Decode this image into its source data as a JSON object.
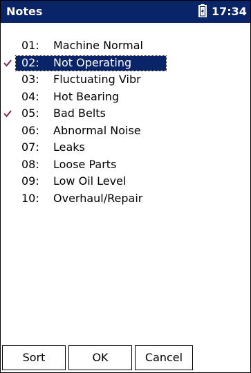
{
  "titlebar": {
    "title": "Notes",
    "time": "17:34",
    "battery_icon": "battery-charging-icon",
    "background": "#0a246a"
  },
  "notes": [
    {
      "num": "01:",
      "label": "Machine Normal",
      "checked": false,
      "selected": false
    },
    {
      "num": "02:",
      "label": "Not Operating",
      "checked": true,
      "selected": true
    },
    {
      "num": "03:",
      "label": "Fluctuating Vibr",
      "checked": false,
      "selected": false
    },
    {
      "num": "04:",
      "label": "Hot Bearing",
      "checked": false,
      "selected": false
    },
    {
      "num": "05:",
      "label": "Bad Belts",
      "checked": true,
      "selected": false
    },
    {
      "num": "06:",
      "label": "Abnormal Noise",
      "checked": false,
      "selected": false
    },
    {
      "num": "07:",
      "label": "Leaks",
      "checked": false,
      "selected": false
    },
    {
      "num": "08:",
      "label": "Loose Parts",
      "checked": false,
      "selected": false
    },
    {
      "num": "09:",
      "label": "Low Oil Level",
      "checked": false,
      "selected": false
    },
    {
      "num": "10:",
      "label": "Overhaul/Repair",
      "checked": false,
      "selected": false
    }
  ],
  "check_color": "#8b2252",
  "selection_color": "#0a246a",
  "buttons": {
    "sort": "Sort",
    "ok": "OK",
    "cancel": "Cancel"
  }
}
